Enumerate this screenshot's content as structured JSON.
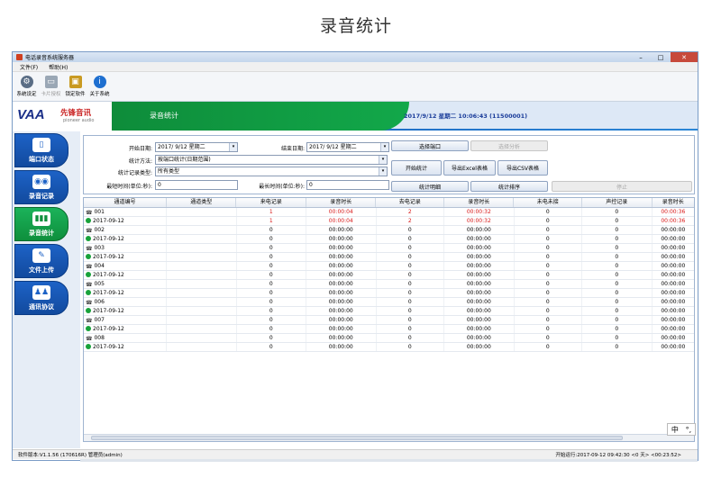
{
  "page_heading": "录音统计",
  "window": {
    "title": "电话录音系统服务器"
  },
  "menu": [
    "文件(F)",
    "帮助(H)"
  ],
  "toolbar": [
    {
      "label": "系统设定",
      "icon": "gear-icon",
      "enabled": true
    },
    {
      "label": "卡片授权",
      "icon": "card-icon",
      "enabled": false
    },
    {
      "label": "锁定软件",
      "icon": "lock-icon",
      "enabled": true
    },
    {
      "label": "关于系统",
      "icon": "info-icon",
      "enabled": true
    }
  ],
  "banner": {
    "logo": "VAA",
    "logo_cn": "先锋音讯",
    "logo_sub": "pioneer audio",
    "section_title": "录音统计",
    "datetime": "2017/9/12 星期二 10:06:43 (11500001)"
  },
  "sidebar": [
    {
      "label": "端口状态",
      "icon": "door-icon",
      "active": false
    },
    {
      "label": "录音记录",
      "icon": "tape-icon",
      "active": false
    },
    {
      "label": "录音统计",
      "icon": "bar-chart-icon",
      "active": true
    },
    {
      "label": "文件上传",
      "icon": "wrench-icon",
      "active": false
    },
    {
      "label": "通讯协议",
      "icon": "people-icon",
      "active": false
    }
  ],
  "form": {
    "start_date_label": "开始日期:",
    "start_date_value": "2017/ 9/12 星期二",
    "end_date_label": "结束日期:",
    "end_date_value": "2017/ 9/12 星期二",
    "method_label": "统计方法:",
    "method_value": "按端口统计(日期范围)",
    "type_label": "统计记录类型:",
    "type_value": "所有类型",
    "min_label": "最短时间(单位:秒):",
    "min_value": "0",
    "max_label": "最长时间(单位:秒):",
    "max_value": "0"
  },
  "buttons": {
    "select_port": "选择端口",
    "option_analysis": "选择分析",
    "start_stats": "开始统计",
    "export_excel": "导出Excel表格",
    "export_csv": "导出CSV表格",
    "stats_detail": "统计明细",
    "stats_sort": "统计排序",
    "stop": "停止"
  },
  "table": {
    "columns": [
      "通道编号",
      "通道类型",
      "来电记录",
      "录音时长",
      "去电记录",
      "录音时长",
      "未电未接",
      "声控记录",
      "录音时长"
    ],
    "rows": [
      {
        "kind": "phone",
        "c": [
          "001",
          "",
          "1",
          "00:00:04",
          "2",
          "00:00:32",
          "0",
          "0",
          "00:00:36"
        ],
        "red": true
      },
      {
        "kind": "ok",
        "c": [
          "2017-09-12",
          "",
          "1",
          "00:00:04",
          "2",
          "00:00:32",
          "0",
          "0",
          "00:00:36"
        ],
        "red": true
      },
      {
        "kind": "phone",
        "c": [
          "002",
          "",
          "0",
          "00:00:00",
          "0",
          "00:00:00",
          "0",
          "0",
          "00:00:00"
        ],
        "red": false
      },
      {
        "kind": "ok",
        "c": [
          "2017-09-12",
          "",
          "0",
          "00:00:00",
          "0",
          "00:00:00",
          "0",
          "0",
          "00:00:00"
        ],
        "red": false
      },
      {
        "kind": "phone",
        "c": [
          "003",
          "",
          "0",
          "00:00:00",
          "0",
          "00:00:00",
          "0",
          "0",
          "00:00:00"
        ],
        "red": false
      },
      {
        "kind": "ok",
        "c": [
          "2017-09-12",
          "",
          "0",
          "00:00:00",
          "0",
          "00:00:00",
          "0",
          "0",
          "00:00:00"
        ],
        "red": false
      },
      {
        "kind": "phone",
        "c": [
          "004",
          "",
          "0",
          "00:00:00",
          "0",
          "00:00:00",
          "0",
          "0",
          "00:00:00"
        ],
        "red": false
      },
      {
        "kind": "ok",
        "c": [
          "2017-09-12",
          "",
          "0",
          "00:00:00",
          "0",
          "00:00:00",
          "0",
          "0",
          "00:00:00"
        ],
        "red": false
      },
      {
        "kind": "phone",
        "c": [
          "005",
          "",
          "0",
          "00:00:00",
          "0",
          "00:00:00",
          "0",
          "0",
          "00:00:00"
        ],
        "red": false
      },
      {
        "kind": "ok",
        "c": [
          "2017-09-12",
          "",
          "0",
          "00:00:00",
          "0",
          "00:00:00",
          "0",
          "0",
          "00:00:00"
        ],
        "red": false
      },
      {
        "kind": "phone",
        "c": [
          "006",
          "",
          "0",
          "00:00:00",
          "0",
          "00:00:00",
          "0",
          "0",
          "00:00:00"
        ],
        "red": false
      },
      {
        "kind": "ok",
        "c": [
          "2017-09-12",
          "",
          "0",
          "00:00:00",
          "0",
          "00:00:00",
          "0",
          "0",
          "00:00:00"
        ],
        "red": false
      },
      {
        "kind": "phone",
        "c": [
          "007",
          "",
          "0",
          "00:00:00",
          "0",
          "00:00:00",
          "0",
          "0",
          "00:00:00"
        ],
        "red": false
      },
      {
        "kind": "ok",
        "c": [
          "2017-09-12",
          "",
          "0",
          "00:00:00",
          "0",
          "00:00:00",
          "0",
          "0",
          "00:00:00"
        ],
        "red": false
      },
      {
        "kind": "phone",
        "c": [
          "008",
          "",
          "0",
          "00:00:00",
          "0",
          "00:00:00",
          "0",
          "0",
          "00:00:00"
        ],
        "red": false
      },
      {
        "kind": "ok",
        "c": [
          "2017-09-12",
          "",
          "0",
          "00:00:00",
          "0",
          "00:00:00",
          "0",
          "0",
          "00:00:00"
        ],
        "red": false
      }
    ]
  },
  "statusbar": {
    "left": "软件版本:V1.1.56 (170616R) 管理员(admin)",
    "right": "开始运行:2017-09-12 09:42:30 <0 天> <00:23:52>"
  },
  "ime": {
    "lang": "中",
    "mode": "°,"
  },
  "colors": {
    "accent_blue": "#1d62c6",
    "active_green": "#0e8f3c",
    "alert_red": "#d81818"
  }
}
